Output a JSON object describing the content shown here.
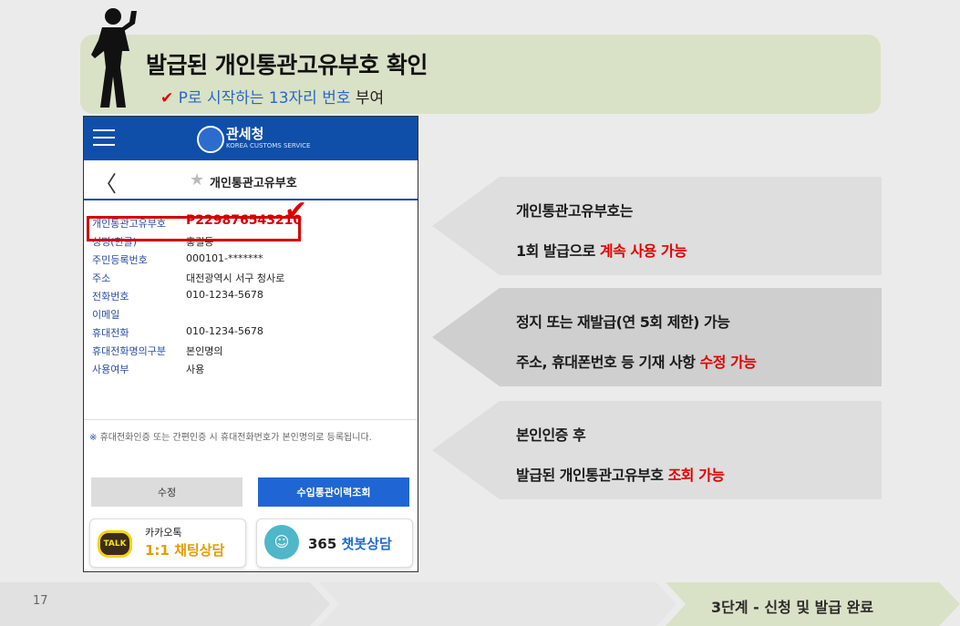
{
  "slide": {
    "title": "발급된  개인통관고유부호  확인",
    "subtitle_check": "✔",
    "subtitle_blue": "P로 시작하는 13자리 번호",
    "subtitle_rest": " 부여",
    "page_number": "17",
    "footer_label": "3단계 - 신청 및 발급 완료"
  },
  "phone": {
    "brand": "관세청",
    "brand_sub": "KOREA CUSTOMS SERVICE",
    "back": "〈",
    "star": "★",
    "page_title": "개인통관고유부호",
    "rows": [
      {
        "label": "개인통관고유부호",
        "value": "P229876543210"
      },
      {
        "label": "성명(한글)",
        "value": "홍길동"
      },
      {
        "label": "주민등록번호",
        "value": "000101-*******"
      },
      {
        "label": "주소",
        "value": "대전광역시 서구 청사로"
      },
      {
        "label": "전화번호",
        "value": "010-1234-5678"
      },
      {
        "label": "이메일",
        "value": ""
      },
      {
        "label": "휴대전화",
        "value": "010-1234-5678"
      },
      {
        "label": "휴대전화명의구분",
        "value": "본인명의"
      },
      {
        "label": "사용여부",
        "value": "사용"
      }
    ],
    "check": "✔",
    "notice_mark": "※",
    "notice": " 휴대전화인증 또는 간편인증 시 휴대전화번호가 본인명의로 등록됩니다.",
    "btn_edit": "수정",
    "btn_history": "수입통관이력조회",
    "kakao_icon": "TALK",
    "kakao_top": "카카오톡",
    "kakao_main": "1:1 채팅상담",
    "bot_icon": "☺",
    "bot_num": "365 ",
    "bot_label": "챗봇상담"
  },
  "callouts": [
    {
      "line1": "개인통관고유부호는",
      "line2_plain": "1회 발급으로 ",
      "line2_red": "계속  사용  가능"
    },
    {
      "line1": "정지 또는 재발급(연 5회  제한) 가능",
      "line2_plain": "주소, 휴대폰번호 등 기재 사항 ",
      "line2_red": "수정 가능"
    },
    {
      "line1": "본인인증 후",
      "line2_plain": "발급된 개인통관고유부호 ",
      "line2_red": "조회 가능"
    }
  ],
  "colors": {
    "banner": "#d9e2c6",
    "header_blue": "#0f4faa",
    "accent_red": "#e00000",
    "callout_gray": "#dedede",
    "callout_dark": "#cfcfcf",
    "footer_green": "#d9e2c6"
  }
}
